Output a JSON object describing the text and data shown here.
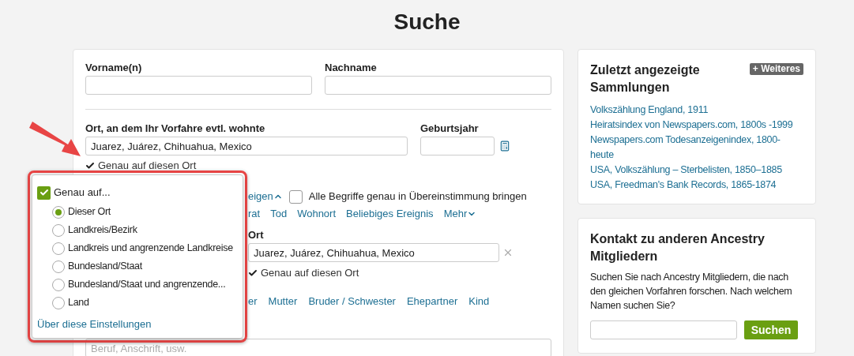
{
  "page_title": "Suche",
  "form": {
    "name_fields": [
      {
        "label": "Vorname(n)"
      },
      {
        "label": "Nachname"
      }
    ],
    "residence": {
      "label": "Ort, an dem Ihr Vorfahre evtl. wohnte",
      "value": "Juarez, Juárez, Chihuahua, Mexico",
      "exact": {
        "label": "Genau auf diesen Ort",
        "checked": true
      }
    },
    "birth_year": {
      "label": "Geburtsjahr"
    },
    "toggle_link": {
      "text": "eigen",
      "expanded": true
    },
    "match_all": {
      "label": "Alle Begriffe genau in Übereinstimmung bringen",
      "checked": false
    },
    "event_links": [
      {
        "text": "rat",
        "kind": "link"
      },
      {
        "text": "Tod",
        "kind": "link"
      },
      {
        "text": "Wohnort",
        "kind": "link"
      },
      {
        "text": "Beliebiges Ereignis",
        "kind": "link"
      },
      {
        "text": "Mehr",
        "kind": "dropdown"
      }
    ],
    "event_place": {
      "label": "Ort",
      "value": "Juarez, Juárez, Chihuahua, Mexico",
      "exact": {
        "label": "Genau auf diesen Ort",
        "checked": true
      }
    },
    "family_links": [
      "er",
      "Mutter",
      "Bruder / Schwester",
      "Ehepartner",
      "Kind"
    ],
    "keyword_field": {
      "placeholder": "Beruf, Anschrift, usw."
    }
  },
  "exact_popover": {
    "title": "Genau auf...",
    "checked": true,
    "options": [
      {
        "label": "Dieser Ort",
        "selected": true
      },
      {
        "label": "Landkreis/Bezirk",
        "selected": false
      },
      {
        "label": "Landkreis und angrenzende Landkreise",
        "selected": false
      },
      {
        "label": "Bundesland/Staat",
        "selected": false
      },
      {
        "label": "Bundesland/Staat und angrenzende...",
        "selected": false
      },
      {
        "label": "Land",
        "selected": false
      }
    ],
    "link": "Über diese Einstellungen"
  },
  "recent_collections": {
    "title": "Zuletzt angezeigte Sammlungen",
    "more_button": "+ Weiteres",
    "links": [
      "Volkszählung England, 1911",
      "Heiratsindex von Newspapers.com, 1800s -1999",
      "Newspapers.com Todesanzeigenindex, 1800-heute",
      "USA, Volkszählung – Sterbelisten, 1850–1885",
      "USA, Freedman's Bank Records, 1865-1874"
    ]
  },
  "member_contact": {
    "title": "Kontakt zu anderen Ancestry Mitgliedern",
    "text": "Suchen Sie nach Ancestry Mitgliedern, die nach den gleichen Vorfahren forschen. Nach welchem Namen suchen Sie?",
    "button": "Suchen"
  }
}
